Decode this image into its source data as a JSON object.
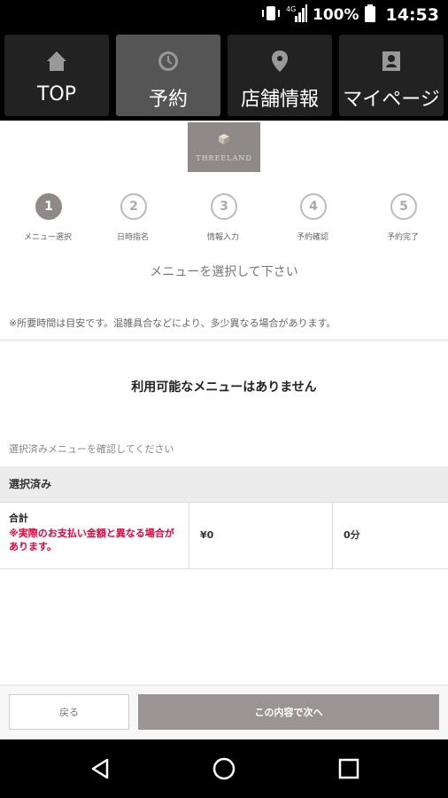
{
  "status_bar": {
    "network": "4G",
    "battery": "100%",
    "time": "14:53"
  },
  "nav": {
    "tabs": [
      {
        "label": "TOP",
        "icon": "home-icon"
      },
      {
        "label": "予約",
        "icon": "clock-icon"
      },
      {
        "label": "店舗情報",
        "icon": "location-pin-icon"
      },
      {
        "label": "マイページ",
        "icon": "profile-icon"
      }
    ],
    "active_tab": "予約"
  },
  "logo": {
    "text": "THREELAND"
  },
  "steps": [
    {
      "number": "1",
      "label": "メニュー選択"
    },
    {
      "number": "2",
      "label": "日時指名"
    },
    {
      "number": "3",
      "label": "情報入力"
    },
    {
      "number": "4",
      "label": "予約確認"
    },
    {
      "number": "5",
      "label": "予約完了"
    }
  ],
  "current_step": "1",
  "instruction": "メニューを選択して下さい",
  "note": "※所要時間は目安です。混雑具合などにより、多少異なる場合があります。",
  "empty_message": "利用可能なメニューはありません",
  "confirm_text": "選択済みメニューを確認してください",
  "selected": {
    "header": "選択済み",
    "total_label": "合計",
    "warning": "※実際のお支払い金額と異なる場合があります。",
    "price": "¥0",
    "duration": "0分"
  },
  "buttons": {
    "back": "戻る",
    "next": "この内容で次へ"
  },
  "colors": {
    "accent": "#8f8a88",
    "warning": "#e8003a",
    "next_button": "#9a9494"
  }
}
